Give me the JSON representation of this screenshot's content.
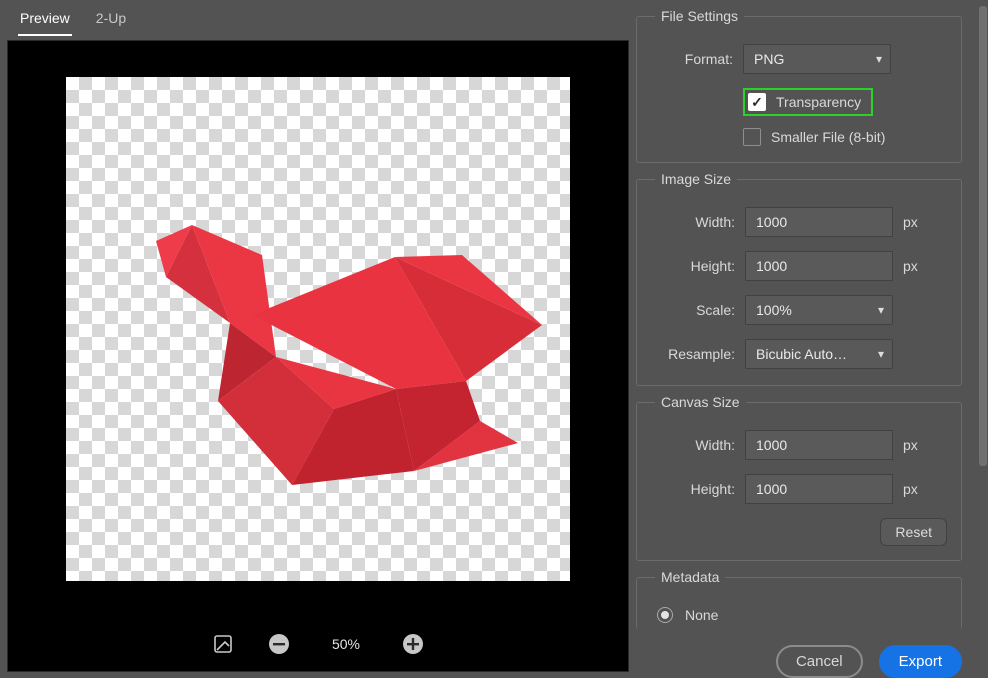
{
  "tabs": {
    "preview": "Preview",
    "twoup": "2-Up"
  },
  "preview": {
    "zoom": "50%"
  },
  "fileSettings": {
    "legend": "File Settings",
    "formatLabel": "Format:",
    "format": "PNG",
    "transparencyLabel": "Transparency",
    "smallerFileLabel": "Smaller File (8-bit)"
  },
  "imageSize": {
    "legend": "Image Size",
    "widthLabel": "Width:",
    "width": "1000",
    "heightLabel": "Height:",
    "height": "1000",
    "scaleLabel": "Scale:",
    "scale": "100%",
    "resampleLabel": "Resample:",
    "resample": "Bicubic Auto…",
    "unit": "px"
  },
  "canvasSize": {
    "legend": "Canvas Size",
    "widthLabel": "Width:",
    "width": "1000",
    "heightLabel": "Height:",
    "height": "1000",
    "unit": "px",
    "reset": "Reset"
  },
  "metadata": {
    "legend": "Metadata",
    "noneLabel": "None"
  },
  "buttons": {
    "cancel": "Cancel",
    "export": "Export"
  }
}
